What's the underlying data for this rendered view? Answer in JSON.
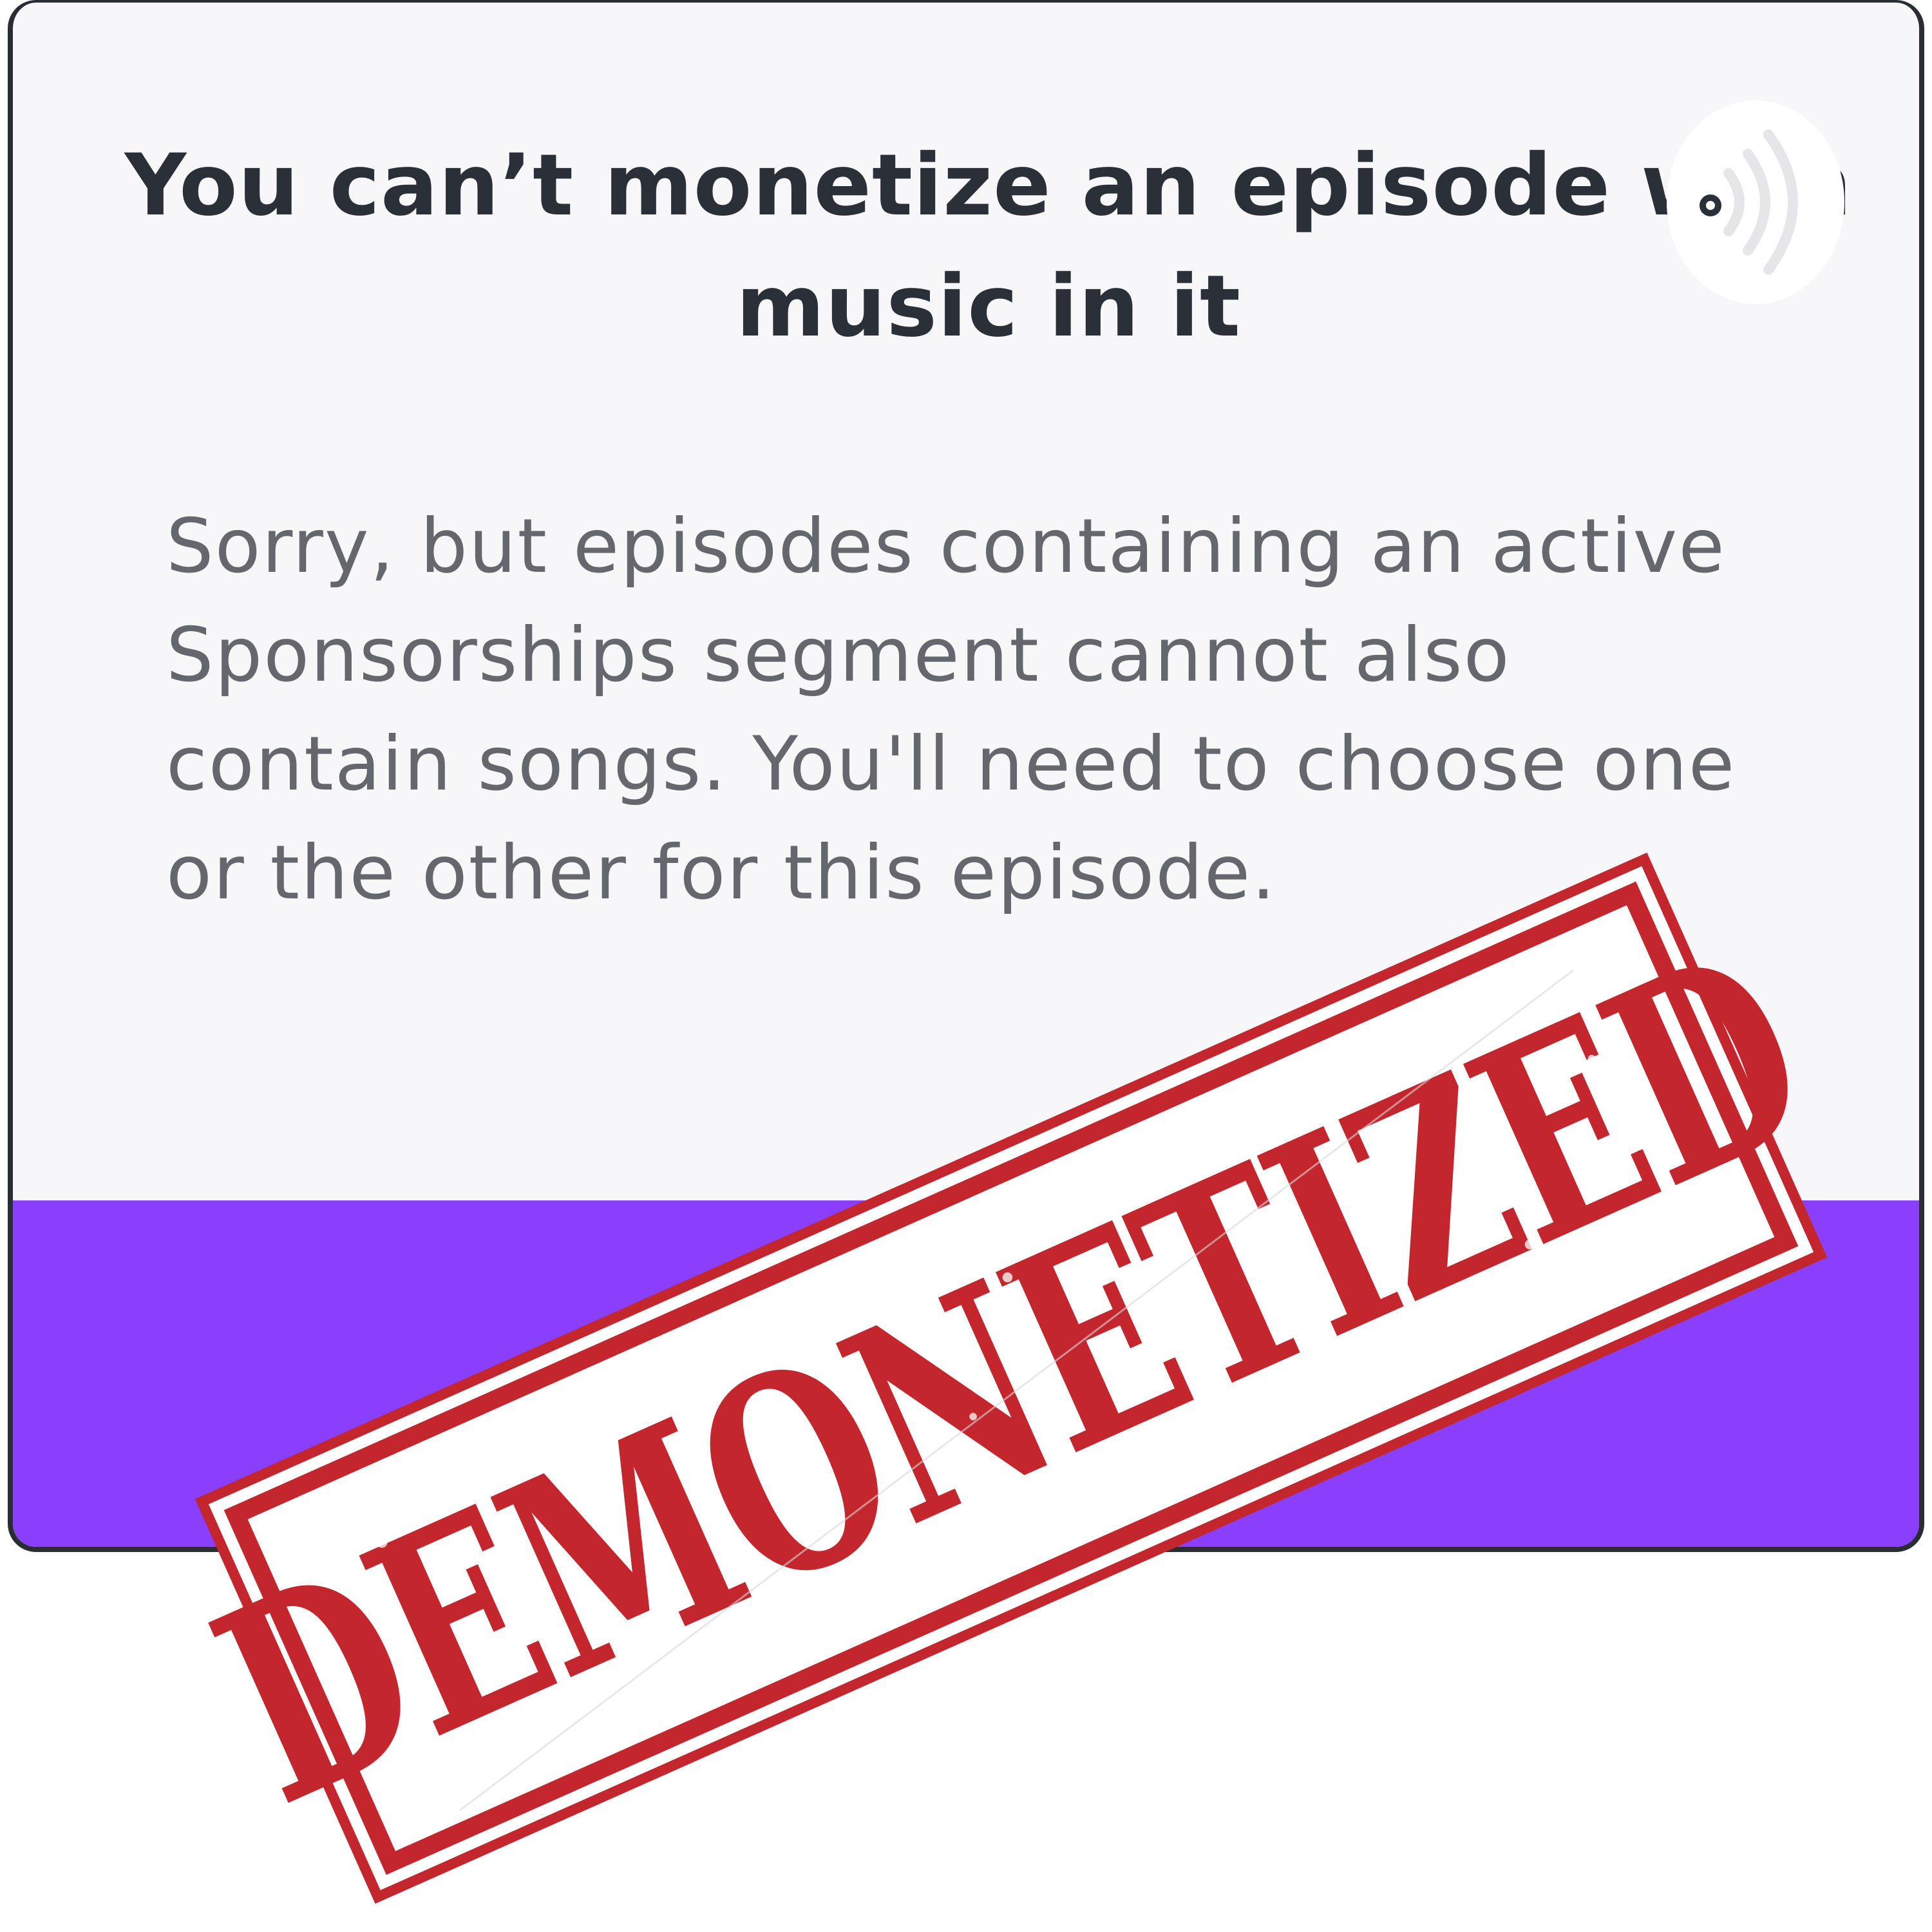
{
  "modal": {
    "title": "You can’t monetize an episode with music in it",
    "body": "Sorry, but episodes containing an active Sponsorships segment cannot also contain songs. You'll need to choose one or the other for this episode."
  },
  "stamp": {
    "text": "DEMONETIZED"
  },
  "icons": {
    "podcast": "podcast-broadcast-icon"
  },
  "colors": {
    "footer": "#8a3ffc",
    "stamp": "#c3262d",
    "title": "#2b2f38",
    "body": "#66676c",
    "modal_bg": "#f7f7f9"
  }
}
